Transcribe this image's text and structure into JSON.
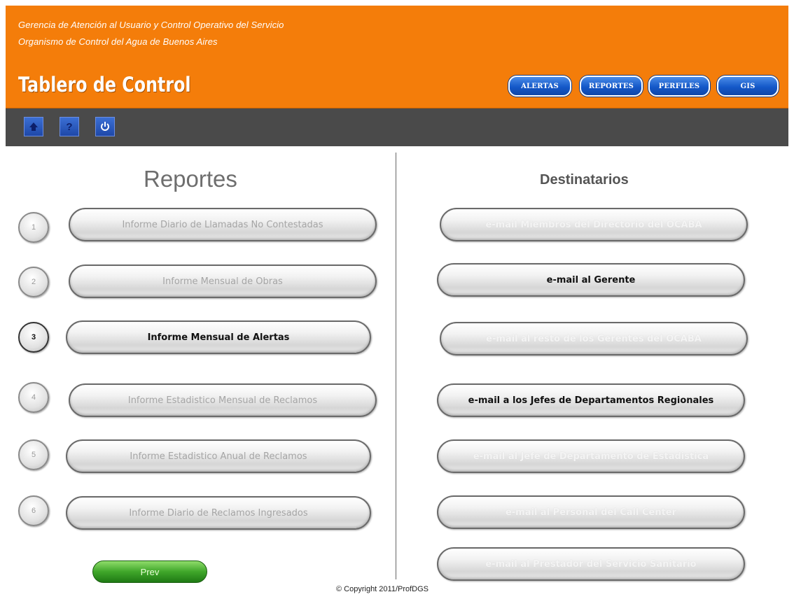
{
  "header": {
    "org_line1": "Gerencia de Atención al Usuario y Control Operativo del Servicio",
    "org_line2": "Organismo de Control del Agua de Buenos Aires",
    "title": "Tablero de Control",
    "nav": [
      "ALERTAS",
      "REPORTES",
      "PERFILES",
      "GIS"
    ],
    "bg_color": "#f47d0a",
    "nav_color": "#1458c8"
  },
  "toolbar": {
    "icons": [
      "home-icon",
      "help-icon",
      "power-icon"
    ],
    "help_glyph": "?"
  },
  "reportes": {
    "title": "Reportes",
    "items": [
      {
        "num": "1",
        "label": "Informe Diario de Llamadas No Contestadas"
      },
      {
        "num": "2",
        "label": "Informe Mensual de Obras"
      },
      {
        "num": "3",
        "label": "Informe Mensual de Alertas"
      },
      {
        "num": "4",
        "label": "Informe Estadistico Mensual de Reclamos"
      },
      {
        "num": "5",
        "label": "Informe Estadistico Anual de Reclamos"
      },
      {
        "num": "6",
        "label": "Informe Diario de Reclamos Ingresados"
      }
    ],
    "prev_label": "Prev"
  },
  "destinatarios": {
    "title": "Destinatarios",
    "items": [
      {
        "label": "e-mail Miembros del Directorio del OCABA"
      },
      {
        "label": "e-mail al Gerente"
      },
      {
        "label": "e-mail al resto de los Gerentes del OCABA"
      },
      {
        "label": "e-mail a los Jefes de Departamentos Regionales"
      },
      {
        "label": "e-mail al Jefe de Departamento de Estadistica"
      },
      {
        "label": "e-mail al Personal del Call Center"
      },
      {
        "label": "e-mail al Prestador del Servicio Sanitario"
      }
    ]
  },
  "footer": {
    "copyright": "© Copyright 2011/ProfDGS"
  }
}
